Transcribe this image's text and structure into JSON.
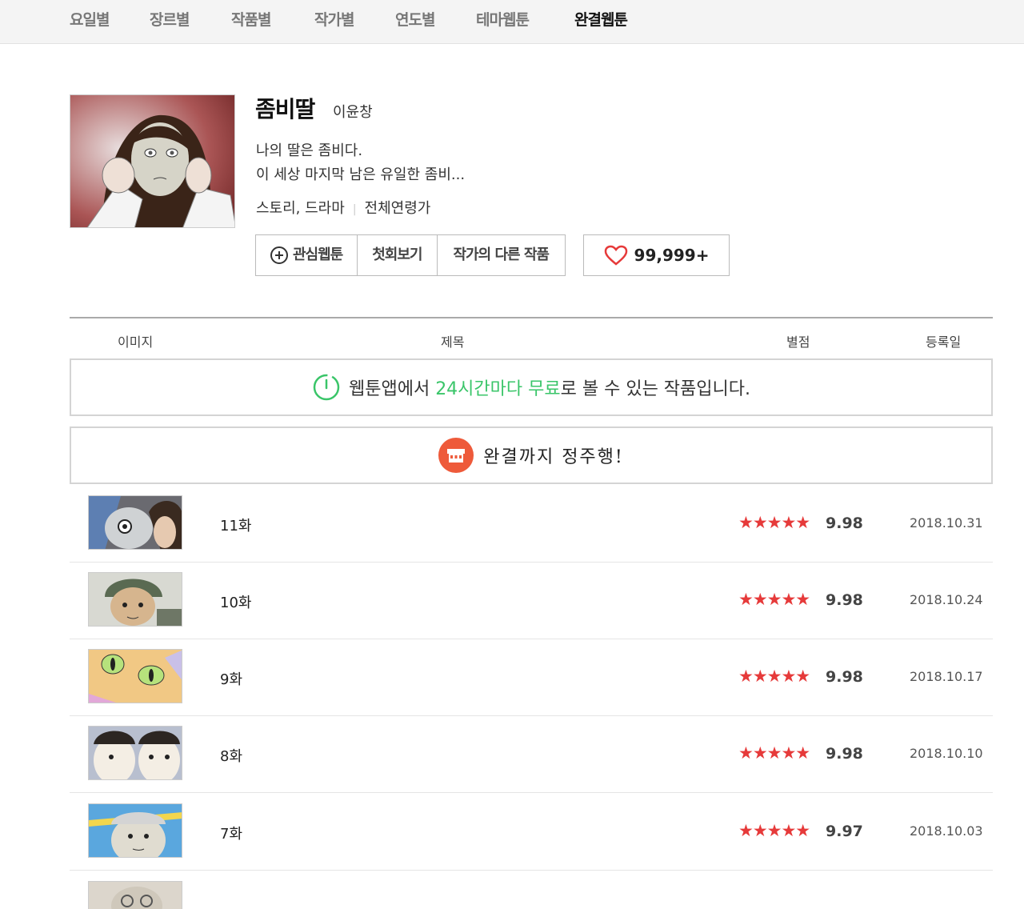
{
  "nav": {
    "tabs": [
      {
        "label": "요일별"
      },
      {
        "label": "장르별"
      },
      {
        "label": "작품별"
      },
      {
        "label": "작가별"
      },
      {
        "label": "연도별"
      },
      {
        "label": "테마웹툰"
      },
      {
        "label": "완결웹툰",
        "active": true
      }
    ]
  },
  "comic": {
    "title": "좀비딸",
    "author": "이윤창",
    "description_line1": "나의 딸은 좀비다.",
    "description_line2": "이 세상 마지막 남은 유일한 좀비...",
    "genre": "스토리, 드라마",
    "age_rating": "전체연령가"
  },
  "actions": {
    "favorite_label": "관심웹툰",
    "first_episode_label": "첫회보기",
    "other_works_label": "작가의 다른 작품",
    "like_count": "99,999+"
  },
  "table": {
    "col_image": "이미지",
    "col_title": "제목",
    "col_rating": "별점",
    "col_date": "등록일"
  },
  "banner_free": {
    "prefix": "웹툰앱에서 ",
    "highlight": "24시간마다 무료",
    "suffix": "로 볼 수 있는 작품입니다."
  },
  "banner_binge": {
    "text": "완결까지 정주행!"
  },
  "episodes": [
    {
      "title": "11화",
      "stars": "★★★★★",
      "rating": "9.98",
      "date": "2018.10.31"
    },
    {
      "title": "10화",
      "stars": "★★★★★",
      "rating": "9.98",
      "date": "2018.10.24"
    },
    {
      "title": "9화",
      "stars": "★★★★★",
      "rating": "9.98",
      "date": "2018.10.17"
    },
    {
      "title": "8화",
      "stars": "★★★★★",
      "rating": "9.98",
      "date": "2018.10.10"
    },
    {
      "title": "7화",
      "stars": "★★★★★",
      "rating": "9.97",
      "date": "2018.10.03"
    }
  ],
  "colors": {
    "accent_green": "#3ac569",
    "star_red": "#e63a3a",
    "heart_red": "#e63a3a"
  }
}
